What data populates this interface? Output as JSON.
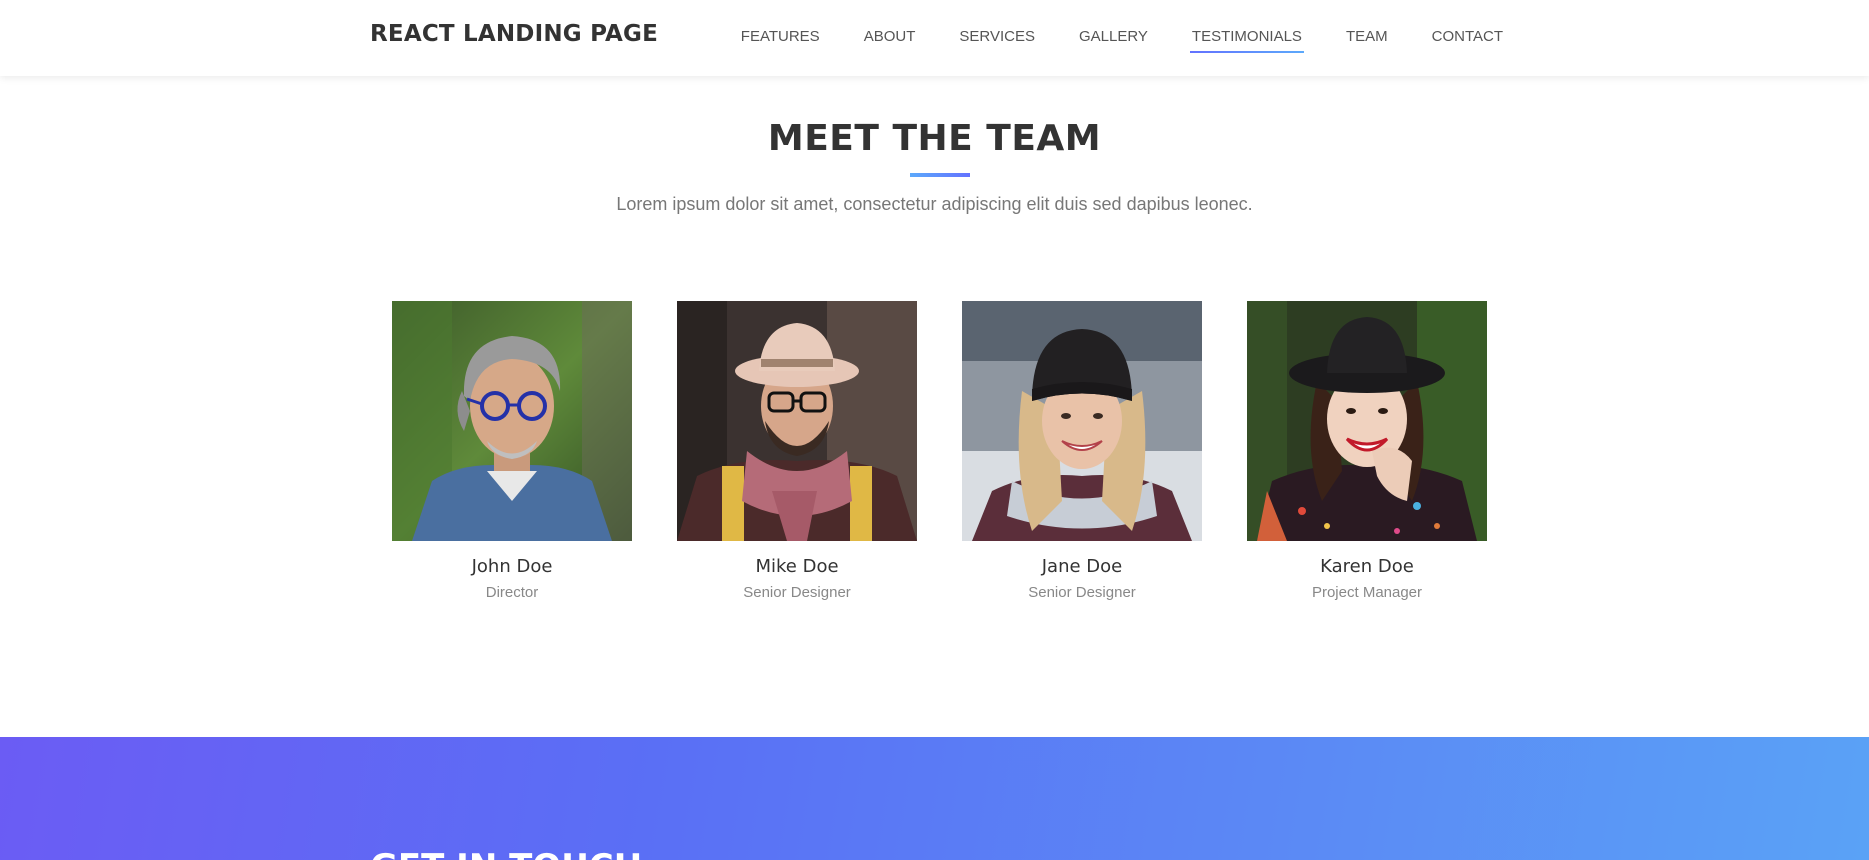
{
  "navbar": {
    "brand": "REACT LANDING PAGE",
    "items": [
      {
        "label": "FEATURES"
      },
      {
        "label": "ABOUT"
      },
      {
        "label": "SERVICES"
      },
      {
        "label": "GALLERY"
      },
      {
        "label": "TESTIMONIALS"
      },
      {
        "label": "TEAM"
      },
      {
        "label": "CONTACT"
      }
    ],
    "active": "TESTIMONIALS"
  },
  "team": {
    "title": "MEET THE TEAM",
    "subtitle": "Lorem ipsum dolor sit amet, consectetur adipiscing elit duis sed dapibus leonec.",
    "members": [
      {
        "name": "John Doe",
        "role": "Director"
      },
      {
        "name": "Mike Doe",
        "role": "Senior Designer"
      },
      {
        "name": "Jane Doe",
        "role": "Senior Designer"
      },
      {
        "name": "Karen Doe",
        "role": "Project Manager"
      }
    ]
  },
  "contact": {
    "title": "GET IN TOUCH"
  },
  "colors": {
    "accent_start": "#6372ff",
    "accent_end": "#5ca9fb"
  }
}
